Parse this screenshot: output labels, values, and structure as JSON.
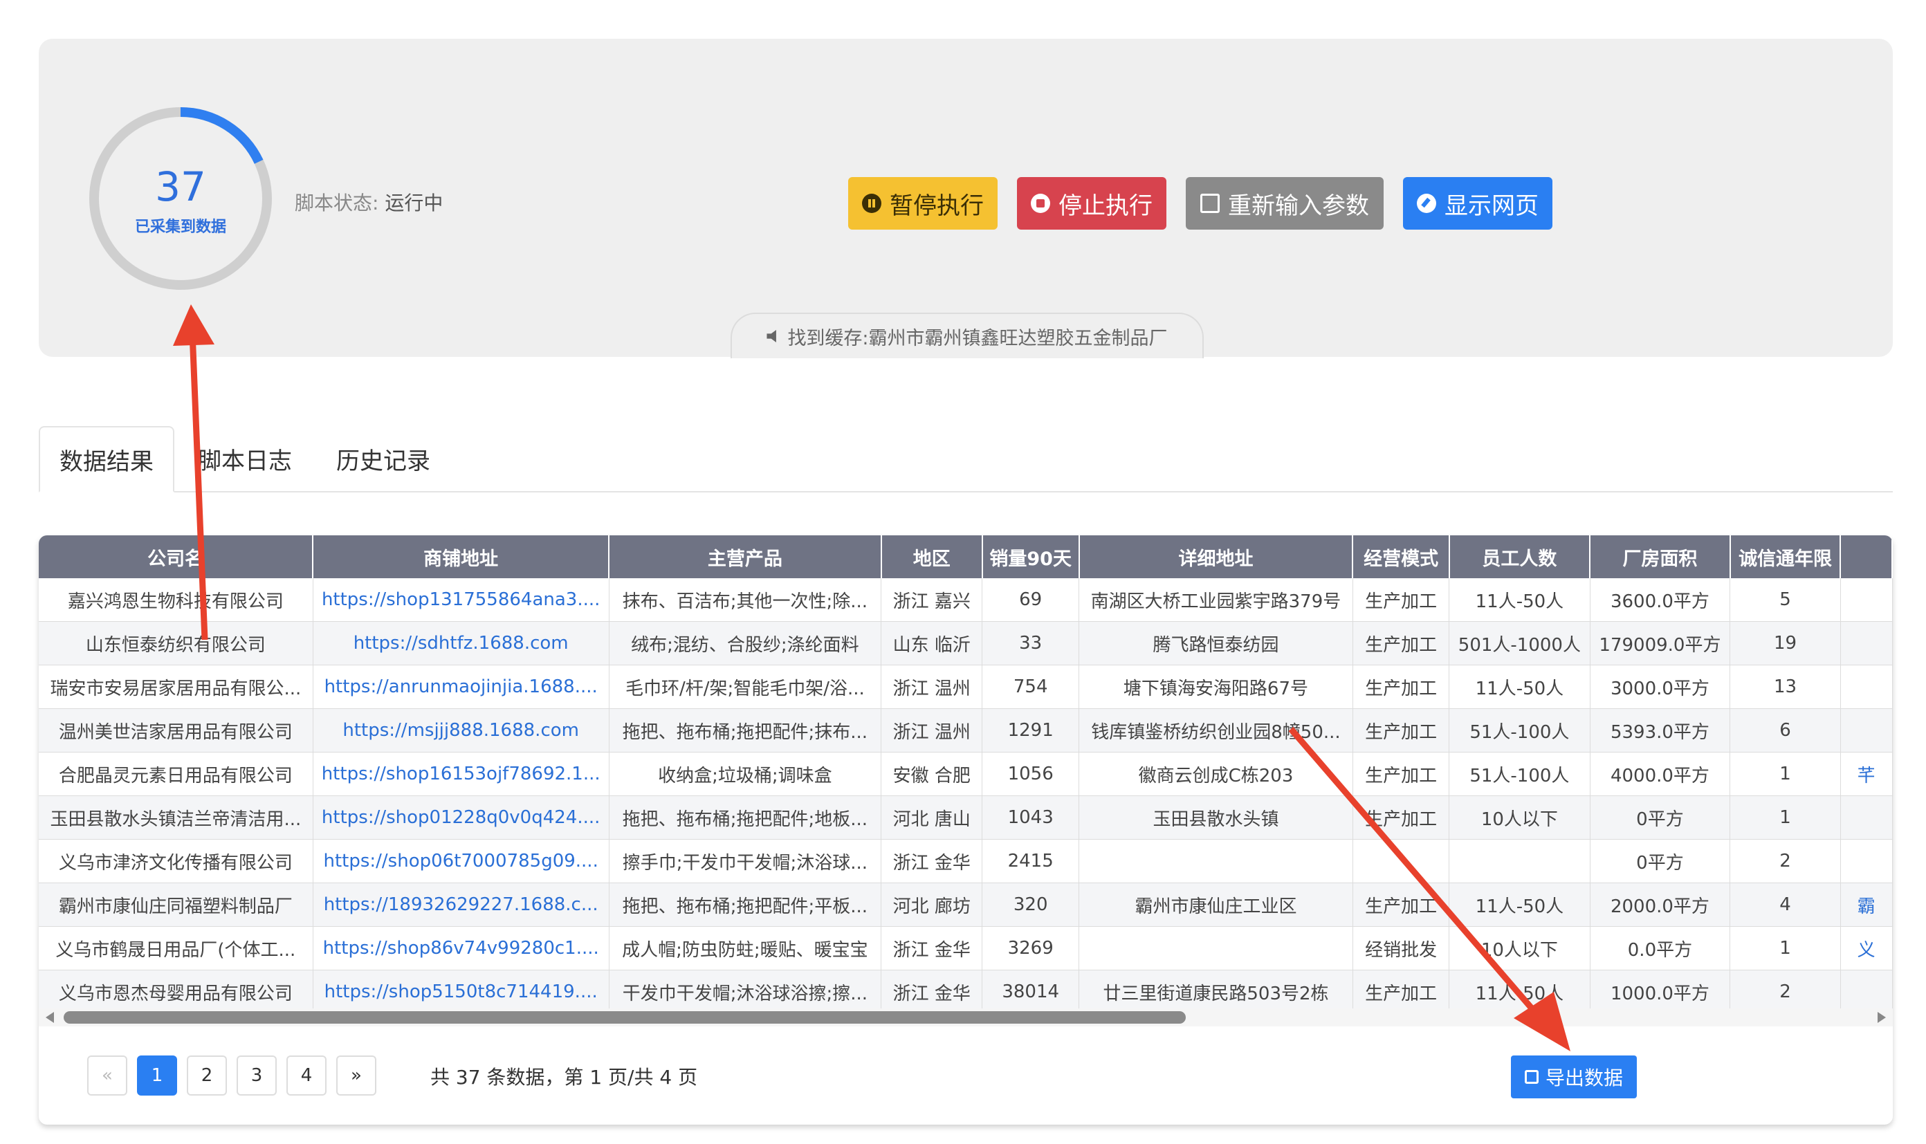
{
  "status": {
    "count": "37",
    "count_label": "已采集到数据",
    "progress_fraction": 0.18,
    "script_status_key": "脚本状态:",
    "script_status_value": "运行中",
    "cache_text": "找到缓存:霸州市霸州镇鑫旺达塑胶五金制品厂"
  },
  "buttons": {
    "pause": "暂停执行",
    "stop": "停止执行",
    "reinput": "重新输入参数",
    "show": "显示网页"
  },
  "tabs": [
    "数据结果",
    "脚本日志",
    "历史记录"
  ],
  "table": {
    "headers": [
      "公司名",
      "商铺地址",
      "主营产品",
      "地区",
      "销量90天",
      "详细地址",
      "经营模式",
      "员工人数",
      "厂房面积",
      "诚信通年限",
      ""
    ],
    "rows": [
      [
        "嘉兴鸿恩生物科技有限公司",
        "https://shop131755864ana3....",
        "抹布、百洁布;其他一次性;除...",
        "浙江 嘉兴",
        "69",
        "南湖区大桥工业园紫宇路379号",
        "生产加工",
        "11人-50人",
        "3600.0平方",
        "5",
        ""
      ],
      [
        "山东恒泰纺织有限公司",
        "https://sdhtfz.1688.com",
        "绒布;混纺、合股纱;涤纶面料",
        "山东 临沂",
        "33",
        "腾飞路恒泰纺园",
        "生产加工",
        "501人-1000人",
        "179009.0平方",
        "19",
        ""
      ],
      [
        "瑞安市安易居家居用品有限公...",
        "https://anrunmaojinjia.1688....",
        "毛巾环/杆/架;智能毛巾架/浴...",
        "浙江 温州",
        "754",
        "塘下镇海安海阳路67号",
        "生产加工",
        "11人-50人",
        "3000.0平方",
        "13",
        ""
      ],
      [
        "温州美世洁家居用品有限公司",
        "https://msjjj888.1688.com",
        "拖把、拖布桶;拖把配件;抹布...",
        "浙江 温州",
        "1291",
        "钱库镇鉴桥纺织创业园8幢50...",
        "生产加工",
        "51人-100人",
        "5393.0平方",
        "6",
        ""
      ],
      [
        "合肥晶灵元素日用品有限公司",
        "https://shop16153ojf78692.1...",
        "收纳盒;垃圾桶;调味盒",
        "安徽 合肥",
        "1056",
        "徽商云创成C栋203",
        "生产加工",
        "51人-100人",
        "4000.0平方",
        "1",
        "芊"
      ],
      [
        "玉田县散水头镇洁兰帝清洁用...",
        "https://shop01228q0v0q424....",
        "拖把、拖布桶;拖把配件;地板...",
        "河北 唐山",
        "1043",
        "玉田县散水头镇",
        "生产加工",
        "10人以下",
        "0平方",
        "1",
        ""
      ],
      [
        "义乌市津济文化传播有限公司",
        "https://shop06t7000785g09....",
        "擦手巾;干发巾干发帽;沐浴球...",
        "浙江 金华",
        "2415",
        "",
        "",
        "",
        "0平方",
        "2",
        ""
      ],
      [
        "霸州市康仙庄同福塑料制品厂",
        "https://18932629227.1688.c...",
        "拖把、拖布桶;拖把配件;平板...",
        "河北 廊坊",
        "320",
        "霸州市康仙庄工业区",
        "生产加工",
        "11人-50人",
        "2000.0平方",
        "4",
        "霸"
      ],
      [
        "义乌市鹤晟日用品厂(个体工...",
        "https://shop86v74v99280c1....",
        "成人帽;防虫防蛀;暖贴、暖宝宝",
        "浙江 金华",
        "3269",
        "",
        "经销批发",
        "10人以下",
        "0.0平方",
        "1",
        "义"
      ],
      [
        "义乌市恩杰母婴用品有限公司",
        "https://shop5150t8c714419....",
        "干发巾干发帽;沐浴球浴擦;擦...",
        "浙江 金华",
        "38014",
        "廿三里街道康民路503号2栋",
        "生产加工",
        "11人-50人",
        "1000.0平方",
        "2",
        ""
      ]
    ]
  },
  "pagination": {
    "prev": "«",
    "pages": [
      "1",
      "2",
      "3",
      "4"
    ],
    "next": "»",
    "info": "共 37 条数据，第 1 页/共 4 页"
  },
  "export_label": "导出数据",
  "colors": {
    "accent": "#2a7ff2",
    "pause": "#f5c131",
    "stop": "#d7434e",
    "neutral": "#8a8a8a",
    "header": "#6f7384",
    "annotation_arrow": "#e8412c"
  }
}
